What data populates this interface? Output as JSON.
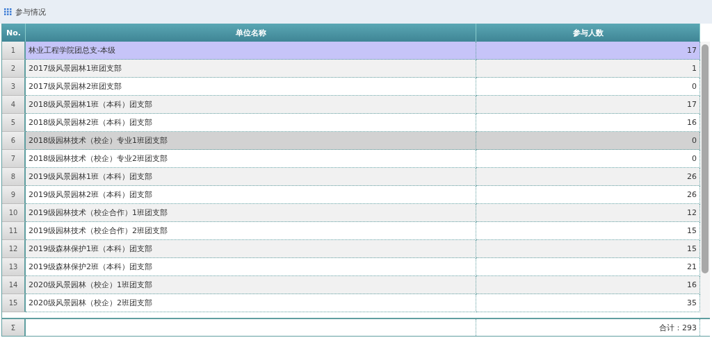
{
  "panel": {
    "title": "参与情况"
  },
  "table": {
    "columns": [
      "No.",
      "单位名称",
      "参与人数"
    ],
    "rows": [
      {
        "no": "1",
        "name": "林业工程学院团总支-本级",
        "count": "17",
        "selected": true,
        "highlighted": false
      },
      {
        "no": "2",
        "name": "2017级风景园林1班团支部",
        "count": "1",
        "selected": false,
        "highlighted": false
      },
      {
        "no": "3",
        "name": "2017级风景园林2班团支部",
        "count": "0",
        "selected": false,
        "highlighted": false
      },
      {
        "no": "4",
        "name": "2018级风景园林1班（本科）团支部",
        "count": "17",
        "selected": false,
        "highlighted": false
      },
      {
        "no": "5",
        "name": "2018级风景园林2班（本科）团支部",
        "count": "16",
        "selected": false,
        "highlighted": false
      },
      {
        "no": "6",
        "name": "2018级园林技术（校企）专业1班团支部",
        "count": "0",
        "selected": false,
        "highlighted": true
      },
      {
        "no": "7",
        "name": "2018级园林技术（校企）专业2班团支部",
        "count": "0",
        "selected": false,
        "highlighted": false
      },
      {
        "no": "8",
        "name": "2019级风景园林1班（本科）团支部",
        "count": "26",
        "selected": false,
        "highlighted": false
      },
      {
        "no": "9",
        "name": "2019级风景园林2班（本科）团支部",
        "count": "26",
        "selected": false,
        "highlighted": false
      },
      {
        "no": "10",
        "name": "2019级园林技术（校企合作）1班团支部",
        "count": "12",
        "selected": false,
        "highlighted": false
      },
      {
        "no": "11",
        "name": "2019级园林技术（校企合作）2班团支部",
        "count": "15",
        "selected": false,
        "highlighted": false
      },
      {
        "no": "12",
        "name": "2019级森林保护1班（本科）团支部",
        "count": "15",
        "selected": false,
        "highlighted": false
      },
      {
        "no": "13",
        "name": "2019级森林保护2班（本科）团支部",
        "count": "21",
        "selected": false,
        "highlighted": false
      },
      {
        "no": "14",
        "name": "2020级风景园林（校企）1班团支部",
        "count": "16",
        "selected": false,
        "highlighted": false
      },
      {
        "no": "15",
        "name": "2020级风景园林（校企）2班团支部",
        "count": "35",
        "selected": false,
        "highlighted": false
      }
    ],
    "footer": {
      "no": "Σ",
      "total": "合计：293"
    }
  }
}
